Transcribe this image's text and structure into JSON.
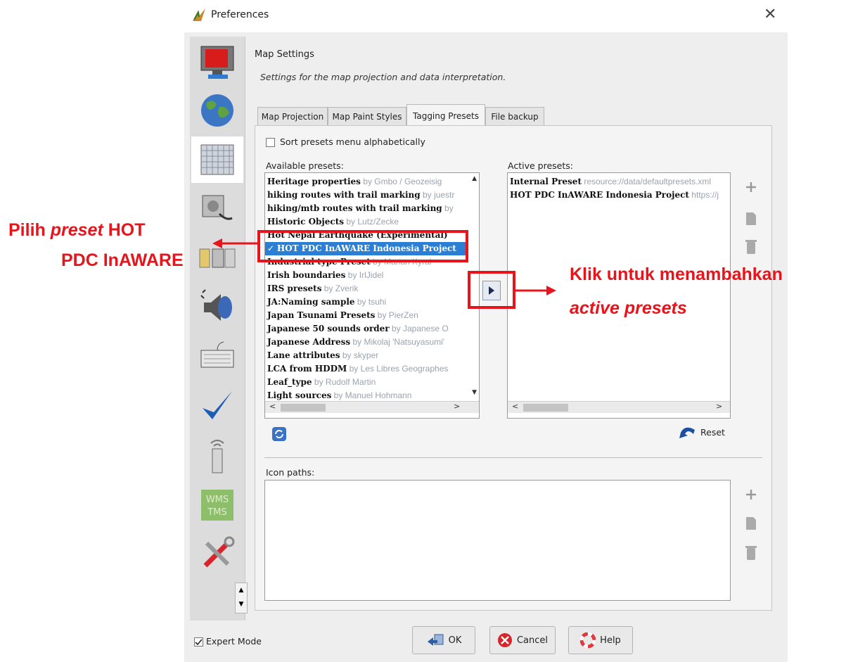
{
  "window": {
    "title": "Preferences"
  },
  "header": {
    "title": "Map Settings",
    "subtitle": "Settings for the map projection and data interpretation."
  },
  "tabs": [
    {
      "label": "Map Projection"
    },
    {
      "label": "Map Paint Styles"
    },
    {
      "label": "Tagging Presets"
    },
    {
      "label": "File backup"
    }
  ],
  "sort_option": {
    "label": "Sort presets menu alphabetically"
  },
  "available": {
    "label": "Available presets:",
    "items": [
      {
        "name": "Heritage properties",
        "by": " by Gmbo / Geozeisig"
      },
      {
        "name": "hiking routes with trail marking",
        "by": " by juestr"
      },
      {
        "name": "hiking/mtb routes with trail marking",
        "by": " by"
      },
      {
        "name": "Historic Objects",
        "by": " by Lutz/Zecke"
      },
      {
        "name": "Hot Nepal Earthquake (Experimental)",
        "by": ""
      },
      {
        "name": "HOT PDC InAWARE Indonesia Project",
        "by": ""
      },
      {
        "name": "Industrial type Preset",
        "by": " by Marian Kyral"
      },
      {
        "name": "Irish boundaries",
        "by": " by IrlJidel"
      },
      {
        "name": "IRS presets",
        "by": " by Zverik"
      },
      {
        "name": "JA:Naming sample",
        "by": " by tsuhi"
      },
      {
        "name": "Japan Tsunami Presets",
        "by": " by PierZen"
      },
      {
        "name": "Japanese 50 sounds order",
        "by": " by Japanese O"
      },
      {
        "name": "Japanese Address",
        "by": " by Mikolaj 'Natsuyasumi'"
      },
      {
        "name": "Lane attributes",
        "by": " by skyper"
      },
      {
        "name": "LCA from HDDM",
        "by": " by Les Libres Geographes"
      },
      {
        "name": "Leaf_type",
        "by": " by Rudolf Martin"
      },
      {
        "name": "Light sources",
        "by": " by Manuel Hohmann"
      }
    ]
  },
  "active": {
    "label": "Active presets:",
    "items": [
      {
        "name": "Internal Preset",
        "by": " resource://data/defaultpresets.xml"
      },
      {
        "name": "HOT PDC InAWARE Indonesia Project",
        "by": " https://j"
      }
    ]
  },
  "reset_label": "Reset",
  "icon_paths_label": "Icon paths:",
  "expert_mode_label": "Expert Mode",
  "buttons": {
    "ok": "OK",
    "cancel": "Cancel",
    "help": "Help"
  },
  "annotations": {
    "left_line1_pre": "Pilih ",
    "left_line1_italic": "preset",
    "left_line1_post": " HOT",
    "left_line2": "PDC InAWARE",
    "right_line1": "Klik untuk menambahkan",
    "right_line2": "active presets"
  },
  "colors": {
    "annotation": "#e8141c",
    "selection": "#2a7fd4"
  }
}
